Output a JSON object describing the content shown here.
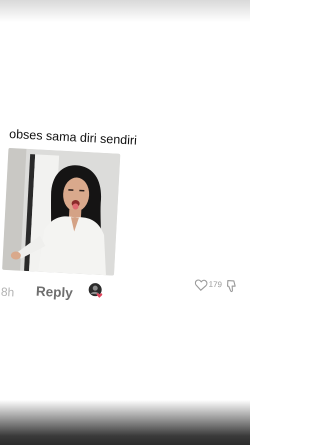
{
  "comment": {
    "text": "obses sama diri sendiri",
    "timestamp": "8h",
    "reply_label": "Reply",
    "like_count": "179"
  },
  "icons": {
    "like": "heart-icon",
    "dislike": "thumbs-down-icon",
    "avatar": "avatar-with-heart"
  },
  "colors": {
    "text": "#111111",
    "muted": "#9a9a9a",
    "reply": "#6e6e6e",
    "heart_badge": "#e0455c"
  }
}
